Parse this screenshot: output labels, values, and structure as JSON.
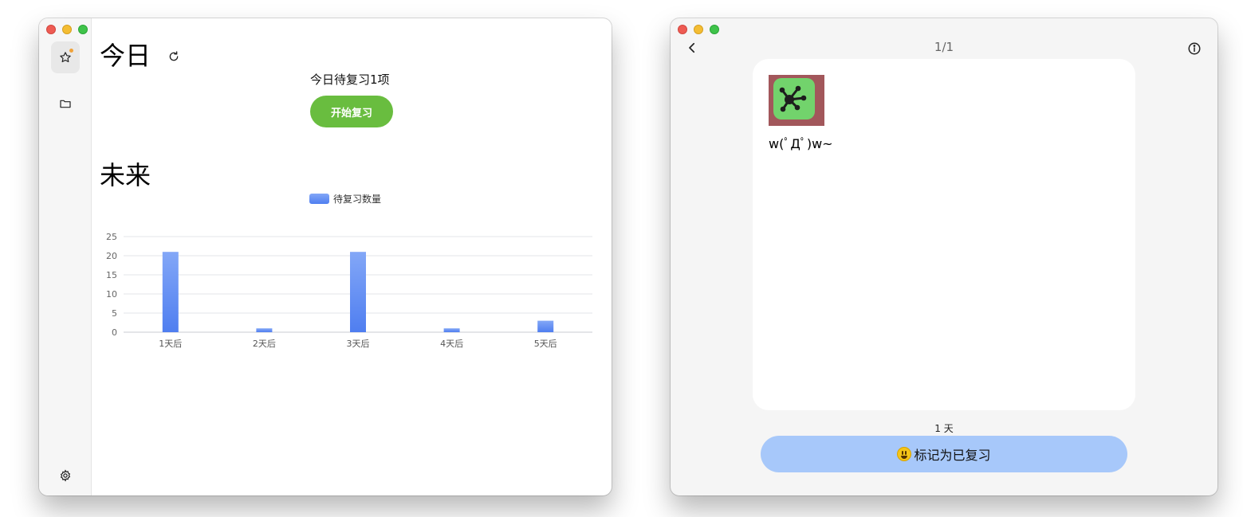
{
  "left_window": {
    "today_title": "今日",
    "due_text": "今日待复习1项",
    "start_button": "开始复习",
    "future_title": "未来",
    "sidebar": [
      "star-icon",
      "folder-icon",
      "gear-icon"
    ]
  },
  "chart_data": {
    "type": "bar",
    "title": "",
    "xlabel": "",
    "ylabel": "",
    "categories": [
      "1天后",
      "2天后",
      "3天后",
      "4天后",
      "5天后"
    ],
    "series": [
      {
        "name": "待复习数量",
        "values": [
          21,
          1,
          21,
          1,
          3
        ],
        "color": "#4f7ef0"
      }
    ],
    "ylim": [
      0,
      25
    ],
    "yticks": [
      0,
      5,
      10,
      15,
      20,
      25
    ],
    "grid": true,
    "legend": "top-center"
  },
  "right_window": {
    "counter": "1/1",
    "card_text": "w(ﾟДﾟ)w~",
    "interval": "1 天",
    "mark_button": "标记为已复习",
    "icons": [
      "back-icon",
      "info-icon",
      "smiley-emoji-icon"
    ]
  },
  "colors": {
    "start_button": "#69bd3f",
    "mark_button": "#a7c8fa",
    "bar": "#4f7ef0"
  }
}
